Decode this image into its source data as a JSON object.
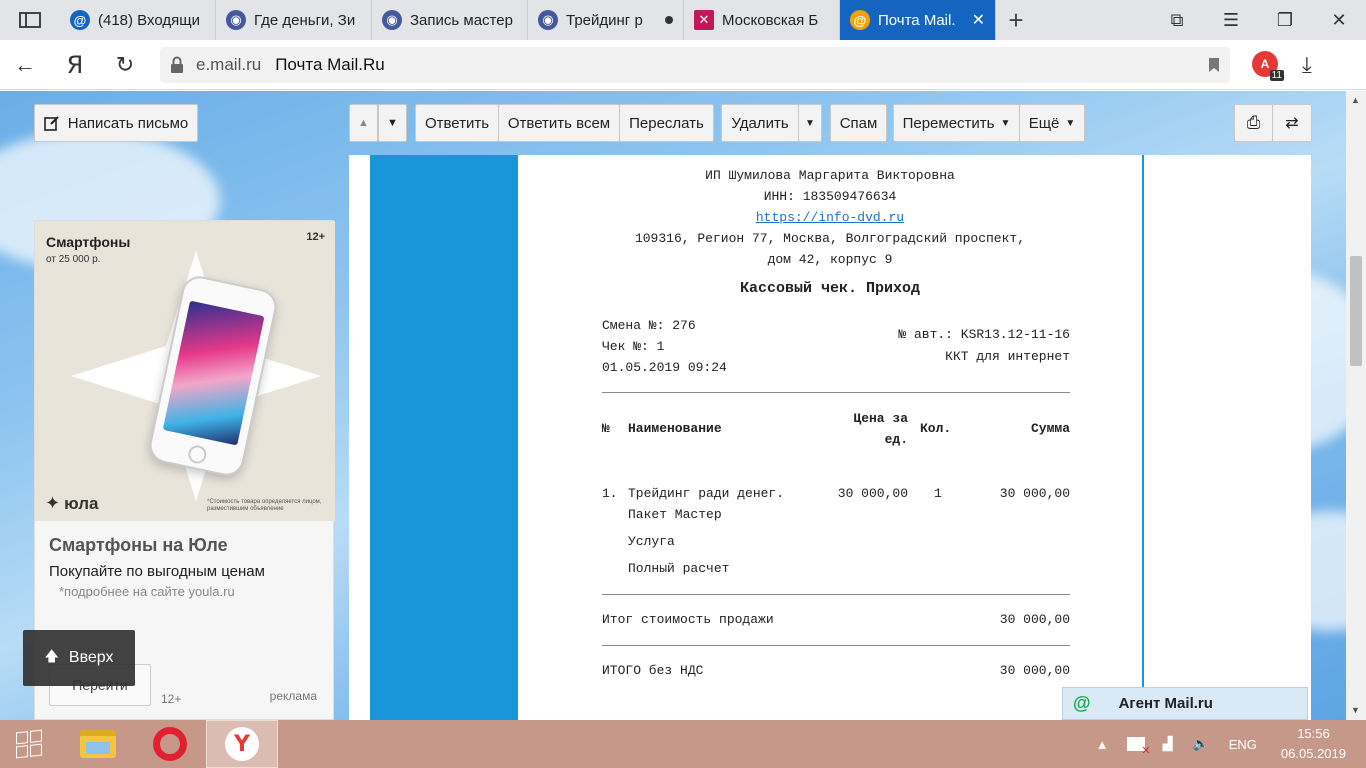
{
  "browser": {
    "tabs": [
      {
        "title": "(418) Входящи",
        "favicon": "mail-at-icon",
        "color": "#1565c0"
      },
      {
        "title": "Где деньги, Зи",
        "favicon": "owl-icon",
        "color": "#455a9b"
      },
      {
        "title": "Запись мастер",
        "favicon": "owl-icon",
        "color": "#455a9b"
      },
      {
        "title": "Трейдинг р",
        "favicon": "owl-icon",
        "color": "#455a9b",
        "unsaved": true
      },
      {
        "title": "Московская Б",
        "favicon": "moex-icon",
        "color": "#c2185b"
      },
      {
        "title": "Почта Mail.",
        "favicon": "mail-at-icon",
        "color": "#f4a400",
        "active": true
      }
    ],
    "address": {
      "domain": "e.mail.ru",
      "page_title": "Почта Mail.Ru"
    },
    "ext_badge_count": "11",
    "ya_letter": "Я",
    "ext_label": "A"
  },
  "toolbar": {
    "compose": "Написать письмо",
    "reply": "Ответить",
    "reply_all": "Ответить всем",
    "forward": "Переслать",
    "delete": "Удалить",
    "spam": "Спам",
    "move": "Переместить",
    "more": "Ещё"
  },
  "ad": {
    "img_title": "Смартфоны",
    "img_sub": "от 25 000 р.",
    "img_age": "12+",
    "logo": "юла",
    "fine_print": "*Стоимость товара определяется лицом, разместившим объявление",
    "heading": "Смартфоны на Юле",
    "desc": "Покупайте по выгодным ценам",
    "note": "*подробнее на сайте youla.ru",
    "go": "Перейти",
    "age": "12+",
    "label": "реклама"
  },
  "up_button": "Вверх",
  "receipt": {
    "seller": "ИП Шумилова Маргарита Викторовна",
    "inn": "ИНН: 183509476634",
    "site": "https://info-dvd.ru",
    "address1": "109316, Регион 77, Москва, Волгоградский проспект,",
    "address2": "дом 42, корпус 9",
    "title": "Кассовый чек. Приход",
    "shift": "Смена №: 276",
    "check_no": "Чек №: 1",
    "datetime": "01.05.2019 09:24",
    "auto_no": "№ авт.: KSR13.12-11-16",
    "kkt": "ККТ для интернет",
    "headers": {
      "num": "№",
      "name": "Наименование",
      "price1": "Цена за",
      "price2": "ед.",
      "qty": "Кол.",
      "sum": "Сумма"
    },
    "item": {
      "num": "1.",
      "name1": "Трейдинг ради денег.",
      "name2": "Пакет Мастер",
      "type": "Услуга",
      "payment": "Полный расчет",
      "price": "30 000,00",
      "qty": "1",
      "sum": "30 000,00"
    },
    "total_label": "Итог стоимость продажи",
    "total_value": "30 000,00",
    "nds_label": "ИТОГО без НДС",
    "nds_value": "30 000,00"
  },
  "agent": {
    "symbol": "@",
    "label": "Агент Mail.ru"
  },
  "taskbar": {
    "lang": "ENG",
    "time": "15:56",
    "date": "06.05.2019",
    "ya_letter": "Y"
  }
}
